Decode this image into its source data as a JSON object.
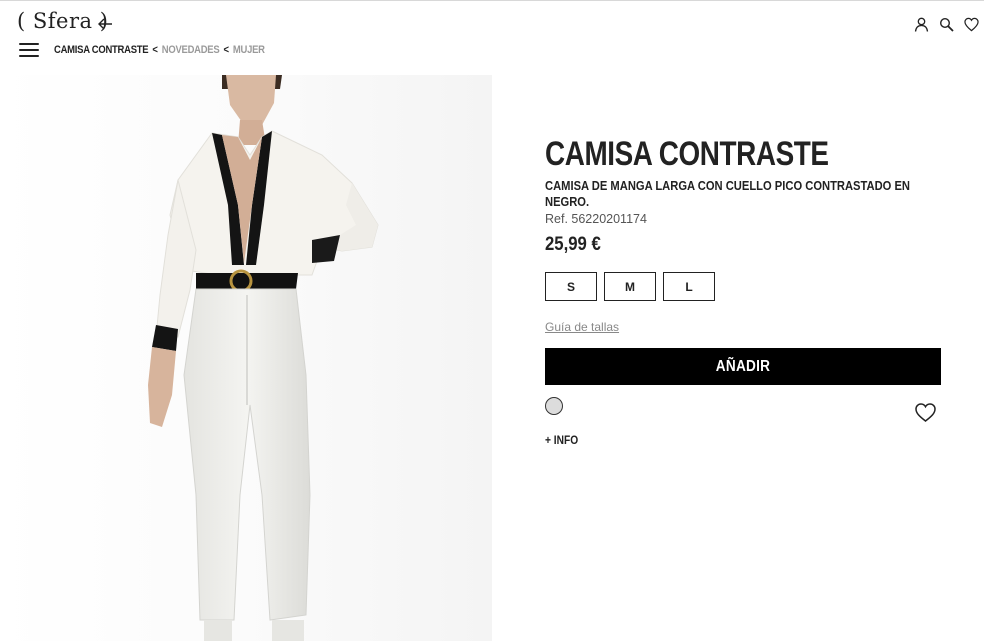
{
  "header": {
    "logo_text": "( Sfera )",
    "breadcrumb": {
      "current": "CAMISA CONTRASTE",
      "separator": "<",
      "items": [
        "NOVEDADES",
        "MUJER"
      ]
    },
    "icons": [
      "back-arrow-icon",
      "menu-icon",
      "user-icon",
      "search-icon",
      "heart-icon"
    ]
  },
  "product": {
    "title": "CAMISA CONTRASTE",
    "description": "CAMISA DE MANGA LARGA CON CUELLO PICO CONTRASTADO EN NEGRO.",
    "ref": "Ref. 56220201174",
    "price": "25,99 €",
    "sizes": [
      "S",
      "M",
      "L"
    ],
    "size_guide": "Guía de tallas",
    "add_button": "AÑADIR",
    "color_swatch": "#dcdcdc",
    "more_info": "+ INFO"
  }
}
